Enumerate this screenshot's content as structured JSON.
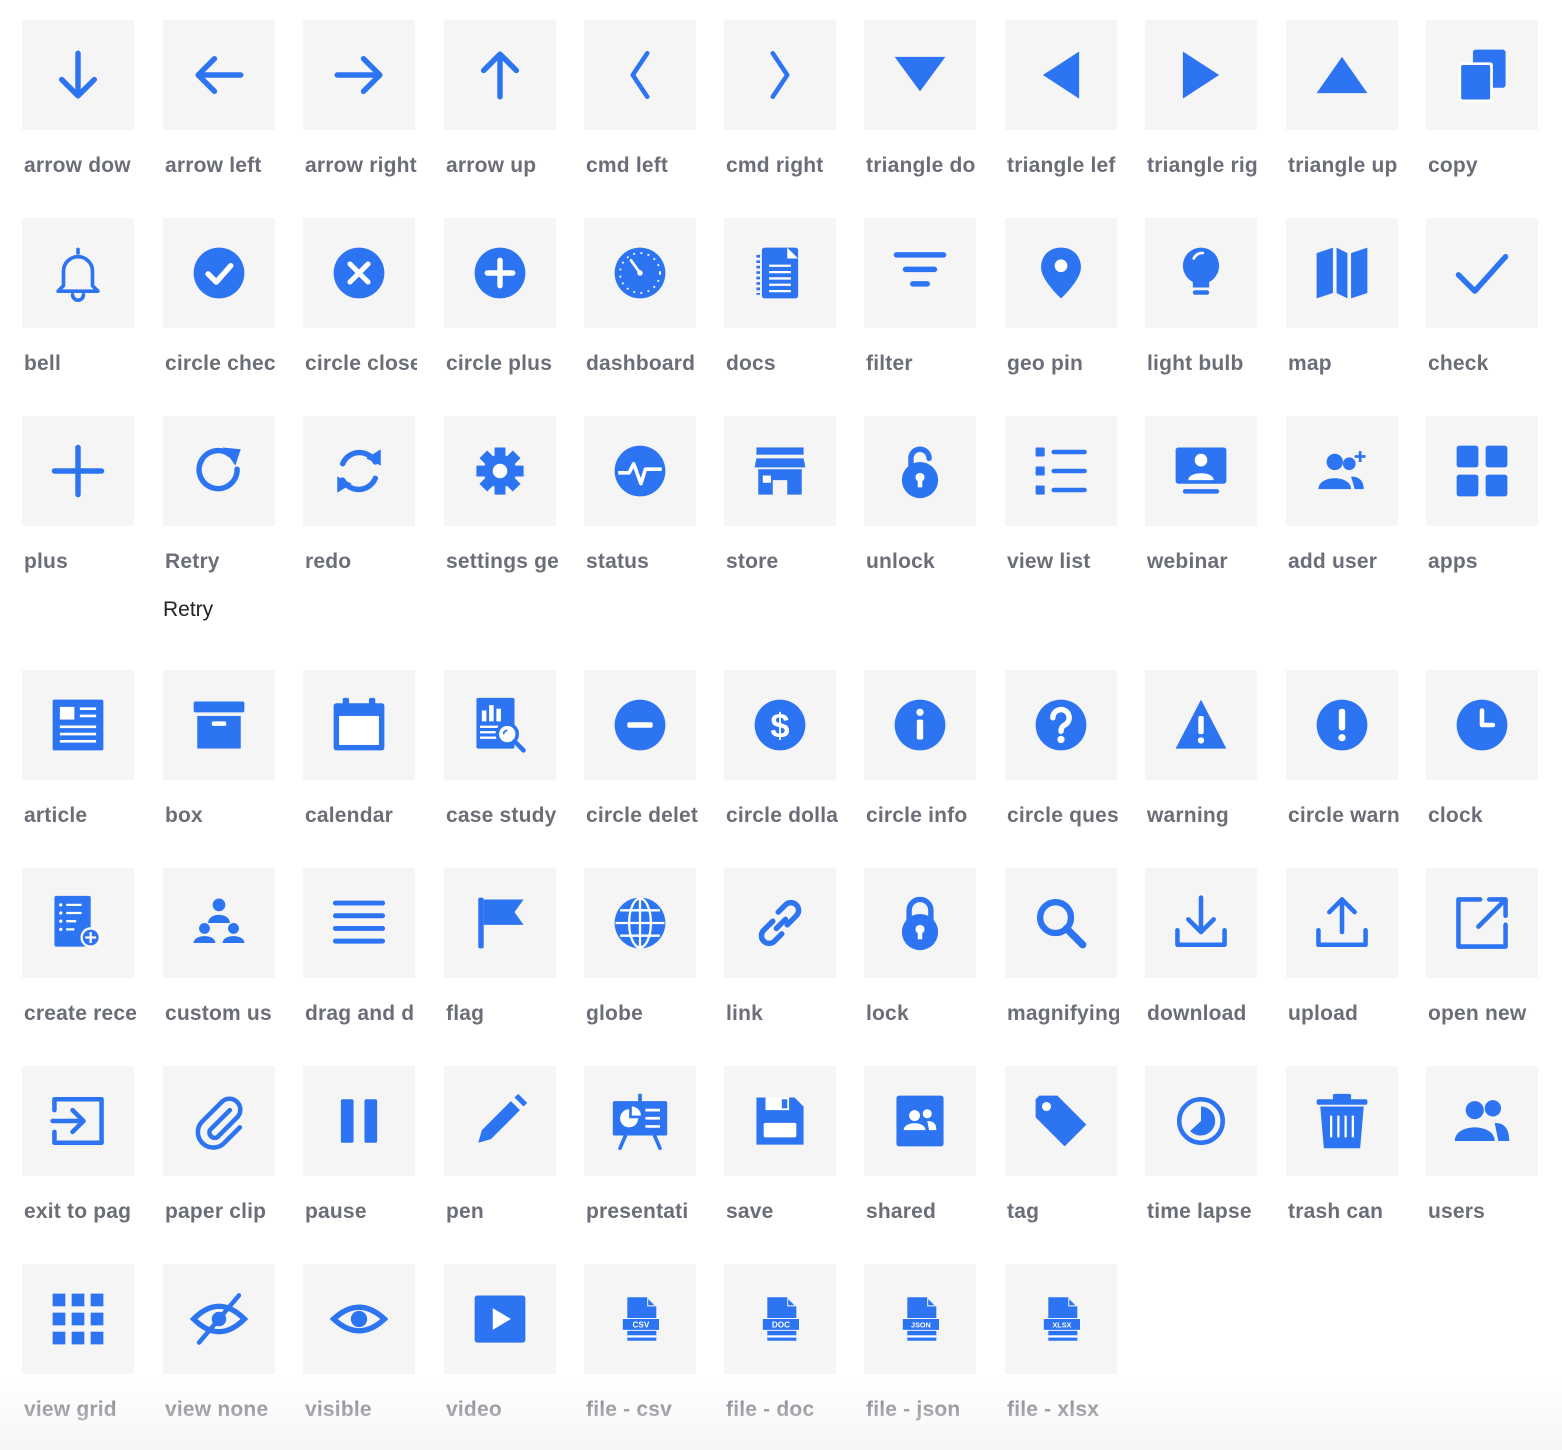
{
  "colors": {
    "icon": "#2c74f2",
    "tile_bg": "#f5f5f6",
    "label": "#6b6e78",
    "tooltip": "#222222"
  },
  "icons": [
    {
      "label": "arrow dow",
      "icon": "arrow-down-icon"
    },
    {
      "label": "arrow left",
      "icon": "arrow-left-icon"
    },
    {
      "label": "arrow right",
      "icon": "arrow-right-icon"
    },
    {
      "label": "arrow up",
      "icon": "arrow-up-icon"
    },
    {
      "label": "cmd left",
      "icon": "cmd-left-icon"
    },
    {
      "label": "cmd right",
      "icon": "cmd-right-icon"
    },
    {
      "label": "triangle do",
      "icon": "triangle-down-icon"
    },
    {
      "label": "triangle lef",
      "icon": "triangle-left-icon"
    },
    {
      "label": "triangle rig",
      "icon": "triangle-right-icon"
    },
    {
      "label": "triangle up",
      "icon": "triangle-up-icon"
    },
    {
      "label": "copy",
      "icon": "copy-icon"
    },
    {
      "label": "bell",
      "icon": "bell-icon"
    },
    {
      "label": "circle chec",
      "icon": "circle-check-icon"
    },
    {
      "label": "circle close",
      "icon": "circle-close-icon"
    },
    {
      "label": "circle plus",
      "icon": "circle-plus-icon"
    },
    {
      "label": "dashboard",
      "icon": "dashboard-icon"
    },
    {
      "label": "docs",
      "icon": "docs-icon"
    },
    {
      "label": "filter",
      "icon": "filter-icon"
    },
    {
      "label": "geo pin",
      "icon": "geo-pin-icon"
    },
    {
      "label": "light bulb",
      "icon": "light-bulb-icon"
    },
    {
      "label": "map",
      "icon": "map-icon"
    },
    {
      "label": "check",
      "icon": "check-icon"
    },
    {
      "label": "plus",
      "icon": "plus-icon"
    },
    {
      "label": "Retry",
      "icon": "retry-icon",
      "tooltip": "Retry"
    },
    {
      "label": "redo",
      "icon": "redo-icon"
    },
    {
      "label": "settings ge",
      "icon": "settings-gear-icon"
    },
    {
      "label": "status",
      "icon": "status-icon"
    },
    {
      "label": "store",
      "icon": "store-icon"
    },
    {
      "label": "unlock",
      "icon": "unlock-icon"
    },
    {
      "label": "view list",
      "icon": "view-list-icon"
    },
    {
      "label": "webinar",
      "icon": "webinar-icon"
    },
    {
      "label": "add user",
      "icon": "add-user-icon"
    },
    {
      "label": "apps",
      "icon": "apps-icon"
    },
    {
      "label": "article",
      "icon": "article-icon"
    },
    {
      "label": "box",
      "icon": "box-icon"
    },
    {
      "label": "calendar",
      "icon": "calendar-icon"
    },
    {
      "label": "case study",
      "icon": "case-study-icon"
    },
    {
      "label": "circle delet",
      "icon": "circle-delete-icon"
    },
    {
      "label": "circle dolla",
      "icon": "circle-dollar-icon"
    },
    {
      "label": "circle info",
      "icon": "circle-info-icon"
    },
    {
      "label": "circle ques",
      "icon": "circle-question-icon"
    },
    {
      "label": "warning",
      "icon": "warning-icon"
    },
    {
      "label": "circle warn",
      "icon": "circle-warning-icon"
    },
    {
      "label": "clock",
      "icon": "clock-icon"
    },
    {
      "label": "create rece",
      "icon": "create-receipt-icon"
    },
    {
      "label": "custom us",
      "icon": "custom-users-icon"
    },
    {
      "label": "drag and d",
      "icon": "drag-and-drop-icon"
    },
    {
      "label": "flag",
      "icon": "flag-icon"
    },
    {
      "label": "globe",
      "icon": "globe-icon"
    },
    {
      "label": "link",
      "icon": "link-icon"
    },
    {
      "label": "lock",
      "icon": "lock-icon"
    },
    {
      "label": "magnifying",
      "icon": "magnifying-glass-icon"
    },
    {
      "label": "download",
      "icon": "download-icon"
    },
    {
      "label": "upload",
      "icon": "upload-icon"
    },
    {
      "label": "open new",
      "icon": "open-new-icon"
    },
    {
      "label": "exit to pag",
      "icon": "exit-to-page-icon"
    },
    {
      "label": "paper clip",
      "icon": "paper-clip-icon"
    },
    {
      "label": "pause",
      "icon": "pause-icon"
    },
    {
      "label": "pen",
      "icon": "pen-icon"
    },
    {
      "label": "presentati",
      "icon": "presentation-icon"
    },
    {
      "label": "save",
      "icon": "save-icon"
    },
    {
      "label": "shared",
      "icon": "shared-icon"
    },
    {
      "label": "tag",
      "icon": "tag-icon"
    },
    {
      "label": "time lapse",
      "icon": "time-lapse-icon"
    },
    {
      "label": "trash can",
      "icon": "trash-can-icon"
    },
    {
      "label": "users",
      "icon": "users-icon"
    },
    {
      "label": "view grid",
      "icon": "view-grid-icon"
    },
    {
      "label": "view none",
      "icon": "view-none-icon"
    },
    {
      "label": "visible",
      "icon": "visible-icon"
    },
    {
      "label": "video",
      "icon": "video-icon"
    },
    {
      "label": "file - csv",
      "icon": "file-csv-icon",
      "file_text": "CSV"
    },
    {
      "label": "file - doc",
      "icon": "file-doc-icon",
      "file_text": "DOC"
    },
    {
      "label": "file - json",
      "icon": "file-json-icon",
      "file_text": "JSON"
    },
    {
      "label": "file - xlsx",
      "icon": "file-xlsx-icon",
      "file_text": "XLSX"
    }
  ]
}
